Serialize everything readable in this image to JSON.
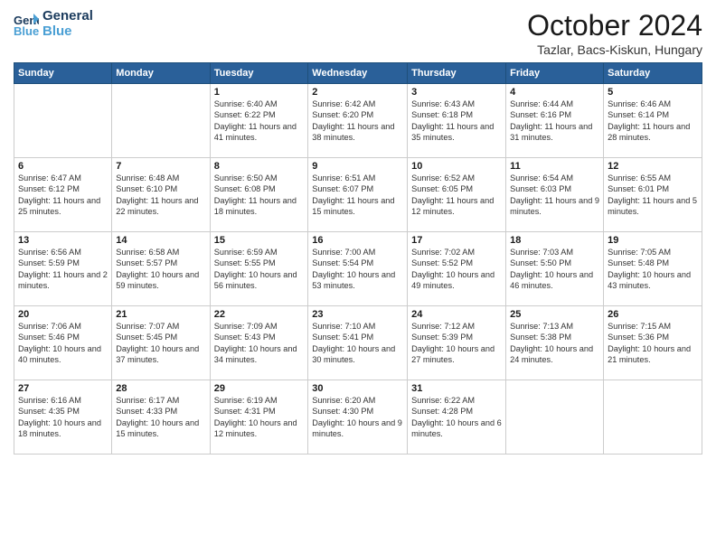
{
  "logo": {
    "line1": "General",
    "line2": "Blue"
  },
  "title": "October 2024",
  "location": "Tazlar, Bacs-Kiskun, Hungary",
  "headers": [
    "Sunday",
    "Monday",
    "Tuesday",
    "Wednesday",
    "Thursday",
    "Friday",
    "Saturday"
  ],
  "weeks": [
    [
      {
        "day": "",
        "info": ""
      },
      {
        "day": "",
        "info": ""
      },
      {
        "day": "1",
        "info": "Sunrise: 6:40 AM\nSunset: 6:22 PM\nDaylight: 11 hours and 41 minutes."
      },
      {
        "day": "2",
        "info": "Sunrise: 6:42 AM\nSunset: 6:20 PM\nDaylight: 11 hours and 38 minutes."
      },
      {
        "day": "3",
        "info": "Sunrise: 6:43 AM\nSunset: 6:18 PM\nDaylight: 11 hours and 35 minutes."
      },
      {
        "day": "4",
        "info": "Sunrise: 6:44 AM\nSunset: 6:16 PM\nDaylight: 11 hours and 31 minutes."
      },
      {
        "day": "5",
        "info": "Sunrise: 6:46 AM\nSunset: 6:14 PM\nDaylight: 11 hours and 28 minutes."
      }
    ],
    [
      {
        "day": "6",
        "info": "Sunrise: 6:47 AM\nSunset: 6:12 PM\nDaylight: 11 hours and 25 minutes."
      },
      {
        "day": "7",
        "info": "Sunrise: 6:48 AM\nSunset: 6:10 PM\nDaylight: 11 hours and 22 minutes."
      },
      {
        "day": "8",
        "info": "Sunrise: 6:50 AM\nSunset: 6:08 PM\nDaylight: 11 hours and 18 minutes."
      },
      {
        "day": "9",
        "info": "Sunrise: 6:51 AM\nSunset: 6:07 PM\nDaylight: 11 hours and 15 minutes."
      },
      {
        "day": "10",
        "info": "Sunrise: 6:52 AM\nSunset: 6:05 PM\nDaylight: 11 hours and 12 minutes."
      },
      {
        "day": "11",
        "info": "Sunrise: 6:54 AM\nSunset: 6:03 PM\nDaylight: 11 hours and 9 minutes."
      },
      {
        "day": "12",
        "info": "Sunrise: 6:55 AM\nSunset: 6:01 PM\nDaylight: 11 hours and 5 minutes."
      }
    ],
    [
      {
        "day": "13",
        "info": "Sunrise: 6:56 AM\nSunset: 5:59 PM\nDaylight: 11 hours and 2 minutes."
      },
      {
        "day": "14",
        "info": "Sunrise: 6:58 AM\nSunset: 5:57 PM\nDaylight: 10 hours and 59 minutes."
      },
      {
        "day": "15",
        "info": "Sunrise: 6:59 AM\nSunset: 5:55 PM\nDaylight: 10 hours and 56 minutes."
      },
      {
        "day": "16",
        "info": "Sunrise: 7:00 AM\nSunset: 5:54 PM\nDaylight: 10 hours and 53 minutes."
      },
      {
        "day": "17",
        "info": "Sunrise: 7:02 AM\nSunset: 5:52 PM\nDaylight: 10 hours and 49 minutes."
      },
      {
        "day": "18",
        "info": "Sunrise: 7:03 AM\nSunset: 5:50 PM\nDaylight: 10 hours and 46 minutes."
      },
      {
        "day": "19",
        "info": "Sunrise: 7:05 AM\nSunset: 5:48 PM\nDaylight: 10 hours and 43 minutes."
      }
    ],
    [
      {
        "day": "20",
        "info": "Sunrise: 7:06 AM\nSunset: 5:46 PM\nDaylight: 10 hours and 40 minutes."
      },
      {
        "day": "21",
        "info": "Sunrise: 7:07 AM\nSunset: 5:45 PM\nDaylight: 10 hours and 37 minutes."
      },
      {
        "day": "22",
        "info": "Sunrise: 7:09 AM\nSunset: 5:43 PM\nDaylight: 10 hours and 34 minutes."
      },
      {
        "day": "23",
        "info": "Sunrise: 7:10 AM\nSunset: 5:41 PM\nDaylight: 10 hours and 30 minutes."
      },
      {
        "day": "24",
        "info": "Sunrise: 7:12 AM\nSunset: 5:39 PM\nDaylight: 10 hours and 27 minutes."
      },
      {
        "day": "25",
        "info": "Sunrise: 7:13 AM\nSunset: 5:38 PM\nDaylight: 10 hours and 24 minutes."
      },
      {
        "day": "26",
        "info": "Sunrise: 7:15 AM\nSunset: 5:36 PM\nDaylight: 10 hours and 21 minutes."
      }
    ],
    [
      {
        "day": "27",
        "info": "Sunrise: 6:16 AM\nSunset: 4:35 PM\nDaylight: 10 hours and 18 minutes."
      },
      {
        "day": "28",
        "info": "Sunrise: 6:17 AM\nSunset: 4:33 PM\nDaylight: 10 hours and 15 minutes."
      },
      {
        "day": "29",
        "info": "Sunrise: 6:19 AM\nSunset: 4:31 PM\nDaylight: 10 hours and 12 minutes."
      },
      {
        "day": "30",
        "info": "Sunrise: 6:20 AM\nSunset: 4:30 PM\nDaylight: 10 hours and 9 minutes."
      },
      {
        "day": "31",
        "info": "Sunrise: 6:22 AM\nSunset: 4:28 PM\nDaylight: 10 hours and 6 minutes."
      },
      {
        "day": "",
        "info": ""
      },
      {
        "day": "",
        "info": ""
      }
    ]
  ]
}
